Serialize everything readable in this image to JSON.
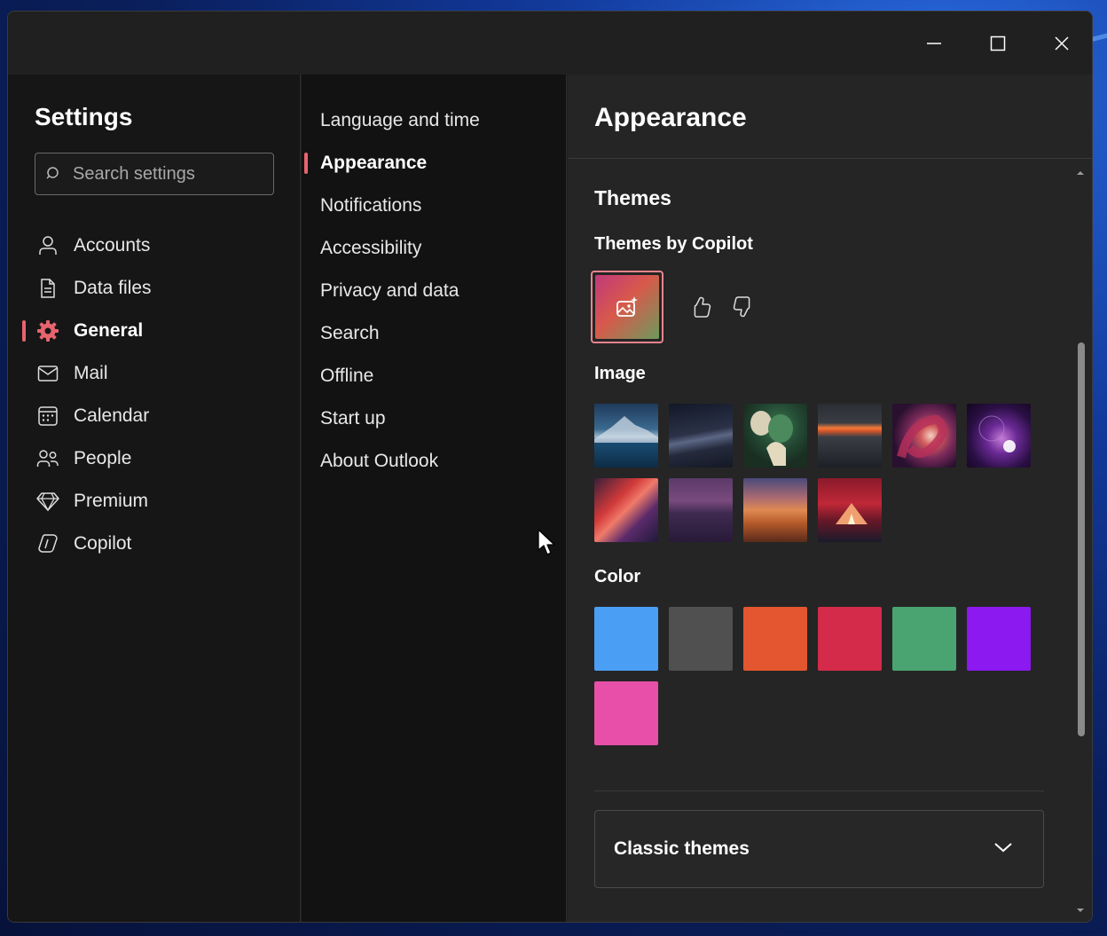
{
  "settings": {
    "title": "Settings",
    "search_placeholder": "Search settings"
  },
  "nav": {
    "items": [
      {
        "label": "Accounts",
        "icon": "person-icon"
      },
      {
        "label": "Data files",
        "icon": "document-icon"
      },
      {
        "label": "General",
        "icon": "gear-icon",
        "active": true
      },
      {
        "label": "Mail",
        "icon": "mail-icon"
      },
      {
        "label": "Calendar",
        "icon": "calendar-icon"
      },
      {
        "label": "People",
        "icon": "people-icon"
      },
      {
        "label": "Premium",
        "icon": "diamond-icon"
      },
      {
        "label": "Copilot",
        "icon": "copilot-icon"
      }
    ]
  },
  "subnav": {
    "items": [
      {
        "label": "Language and time"
      },
      {
        "label": "Appearance",
        "active": true
      },
      {
        "label": "Notifications"
      },
      {
        "label": "Accessibility"
      },
      {
        "label": "Privacy and data"
      },
      {
        "label": "Search"
      },
      {
        "label": "Offline"
      },
      {
        "label": "Start up"
      },
      {
        "label": "About Outlook"
      }
    ]
  },
  "pane": {
    "title": "Appearance",
    "themes_heading": "Themes",
    "copilot_heading": "Themes by Copilot",
    "image_heading": "Image",
    "color_heading": "Color",
    "classic_label": "Classic themes"
  },
  "colors": {
    "accent": "#e7646f",
    "swatches": [
      "#4a9ff5",
      "#505050",
      "#e3562f",
      "#d52b4a",
      "#4aa472",
      "#8c19ef",
      "#e84fa8"
    ]
  },
  "image_themes": [
    "mountain-lake",
    "dunes-night",
    "green-sculpture",
    "sunset-ridge",
    "swirl-red",
    "purple-orbs",
    "abstract-shapes",
    "purple-desert",
    "orange-dunes",
    "red-tent"
  ]
}
